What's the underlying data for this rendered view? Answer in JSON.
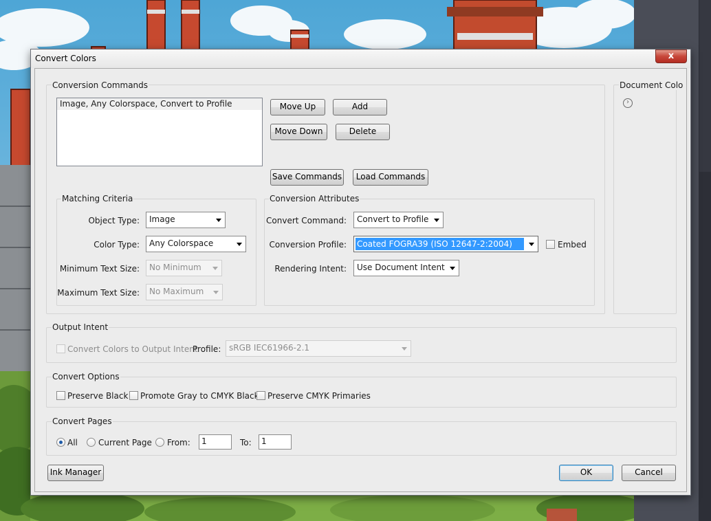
{
  "dialog": {
    "title": "Convert Colors",
    "close_glyph": "x"
  },
  "conversion_commands": {
    "label": "Conversion Commands",
    "items": [
      "Image, Any Colorspace, Convert to Profile"
    ],
    "buttons": {
      "move_up": "Move Up",
      "add": "Add",
      "move_down": "Move Down",
      "delete": "Delete",
      "save": "Save Commands",
      "load": "Load Commands"
    }
  },
  "matching_criteria": {
    "label": "Matching Criteria",
    "object_type_label": "Object Type:",
    "object_type": "Image",
    "color_type_label": "Color Type:",
    "color_type": "Any Colorspace",
    "min_text_label": "Minimum Text Size:",
    "min_text": "No Minimum",
    "max_text_label": "Maximum Text Size:",
    "max_text": "No Maximum"
  },
  "conversion_attributes": {
    "label": "Conversion Attributes",
    "command_label": "Convert Command:",
    "command": "Convert to Profile",
    "profile_label": "Conversion Profile:",
    "profile": "Coated FOGRA39 (ISO 12647-2:2004)",
    "embed_label": "Embed",
    "intent_label": "Rendering Intent:",
    "intent": "Use Document Intent"
  },
  "document_colors": {
    "label": "Document Colo"
  },
  "output_intent": {
    "label": "Output Intent",
    "convert_label": "Convert Colors to Output Intent",
    "profile_label": "Profile:",
    "profile": "sRGB IEC61966-2.1"
  },
  "convert_options": {
    "label": "Convert Options",
    "preserve_black": "Preserve Black",
    "promote_gray": "Promote Gray to CMYK Black",
    "preserve_cmyk": "Preserve CMYK Primaries"
  },
  "convert_pages": {
    "label": "Convert Pages",
    "all": "All",
    "current": "Current Page",
    "from": "From:",
    "to": "To:",
    "from_value": "1",
    "to_value": "1",
    "selected": "All"
  },
  "footer": {
    "ink_manager": "Ink Manager",
    "ok": "OK",
    "cancel": "Cancel"
  }
}
